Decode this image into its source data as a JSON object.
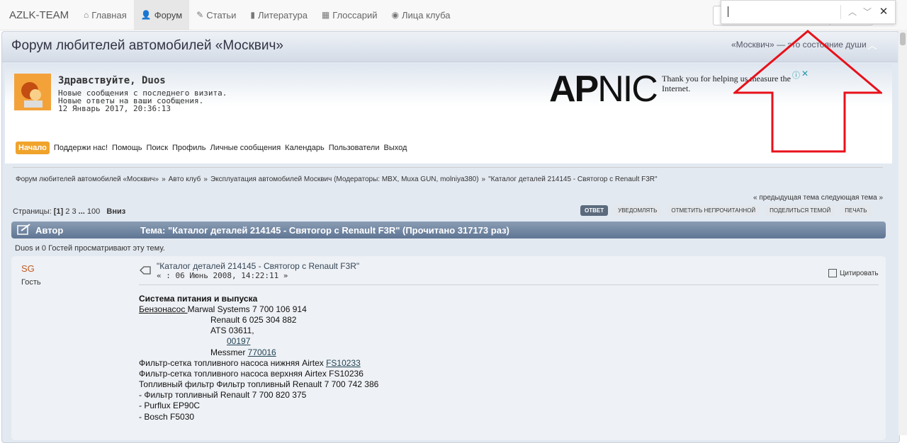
{
  "nav": {
    "brand": "AZLK-TEAM",
    "items": [
      {
        "label": "Главная",
        "icon": "home-icon",
        "glyph": "⌂"
      },
      {
        "label": "Форум",
        "icon": "user-icon",
        "glyph": "👤"
      },
      {
        "label": "Статьи",
        "icon": "pencil-icon",
        "glyph": "✎"
      },
      {
        "label": "Литература",
        "icon": "book-icon",
        "glyph": "▮"
      },
      {
        "label": "Глоссарий",
        "icon": "table-icon",
        "glyph": "▦"
      },
      {
        "label": "Лица клуба",
        "icon": "eye-icon",
        "glyph": "◉"
      }
    ]
  },
  "findbar": {
    "value": ""
  },
  "forum": {
    "title": "Форум любителей автомобилей «Москвич»",
    "slogan": "«Москвич» — это состояние души"
  },
  "user": {
    "greeting": "Здравствуйте, Duos",
    "line1": "Новые сообщения с последнего визита.",
    "line2": "Новые ответы на ваши сообщения.",
    "datetime": "12 Январь 2017, 20:36:13"
  },
  "ad": {
    "logo_bold": "AP",
    "logo_thin": "NIC",
    "text": "Thank you for helping us measure the Internet."
  },
  "menu": [
    "Начало",
    "Поддержи нас!",
    "Помощь",
    "Поиск",
    "Профиль",
    "Личные сообщения",
    "Календарь",
    "Пользователи",
    "Выход"
  ],
  "breadcrumb": [
    "Форум любителей автомобилей «Москвич»",
    "Авто клуб",
    "Эксплуатация автомобилей Москвич (Модераторы: MBX, Muxa GUN, molniya380)",
    "\"Каталог деталей 214145 - Святогор с Renault F3R\""
  ],
  "prevnext": "« предыдущая тема следующая тема »",
  "pages": {
    "label": "Страницы:",
    "current": "[1]",
    "p2": "2",
    "p3": "3",
    "dots": "...",
    "last": "100",
    "down": "Вниз"
  },
  "buttons": [
    "ОТВЕТ",
    "УВЕДОМЛЯТЬ",
    "ОТМЕТИТЬ НЕПРОЧИТАННОЙ",
    "ПОДЕЛИТЬСЯ ТЕМОЙ",
    "ПЕЧАТЬ"
  ],
  "topic": {
    "author_label": "Автор",
    "title": "Тема: \"Каталог деталей 214145 - Святогор с Renault F3R\"  (Прочитано 317173 раз)"
  },
  "viewers": "Duos и 0 Гостей просматривают эту тему.",
  "post": {
    "poster": "SG",
    "rank": "Гость",
    "subject": "\"Каталог деталей 214145 - Святогор с Renault F3R\"",
    "date": "« : 06 Июнь 2008, 14:22:11 »",
    "quote": "Цитировать",
    "heading": "Система питания и выпуска",
    "l1a": "Бензонасос ",
    "l1b": "Marwal Systems 7 700 106 914",
    "l2": "Renault 6 025 304 882",
    "l3": "ATS 03611,",
    "l4": "00197",
    "l5a": "Messmer ",
    "l5b": "770016",
    "l6a": "Фильтр-сетка топливного насоса нижняя Airtex  ",
    "l6b": "FS10233",
    "l7": "Фильтр-сетка топливного насоса верхняя Airtex FS10236",
    "l8": "Топливный фильтр   Фильтр топливный Renault 7 700 742 386",
    "l9": "-   Фильтр топливный Renault 7 700 820 375",
    "l10": "-   Purflux   EP90C",
    "l11": "-   Bosch    F5030"
  },
  "colors": {
    "accent": "#f0a32b",
    "topicbar": "#6f84a0",
    "arrow": "#e8101a",
    "poster": "#c25b22"
  }
}
